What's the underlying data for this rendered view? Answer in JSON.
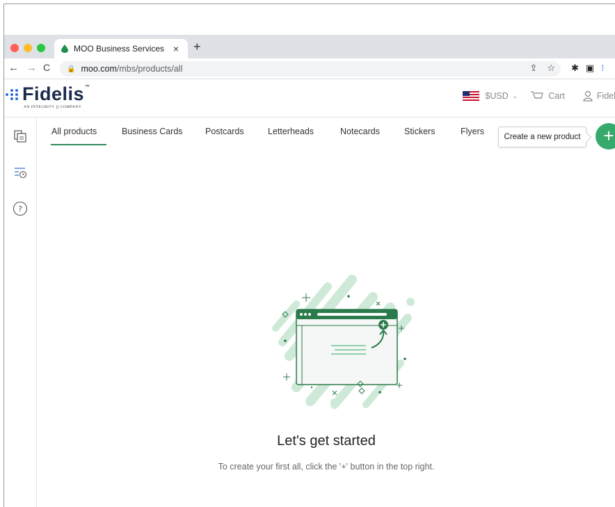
{
  "browser": {
    "tab_title": "MOO Business Services",
    "tab_close": "×",
    "new_tab": "+",
    "url_host": "moo.com",
    "url_path": "/mbs/products/all"
  },
  "header": {
    "logo_text": "Fidelis",
    "logo_tm": "™",
    "logo_sub": "AN INTEGRITY ][ COMPANY",
    "currency": "$USD",
    "cart": "Cart",
    "user": "Fidel"
  },
  "categories": [
    {
      "label": "All products",
      "active": true
    },
    {
      "label": "Business Cards"
    },
    {
      "label": "Postcards"
    },
    {
      "label": "Letterheads"
    },
    {
      "label": "Notecards"
    },
    {
      "label": "Stickers"
    },
    {
      "label": "Flyers"
    }
  ],
  "tooltip": "Create a new product",
  "fab": "+",
  "empty_state": {
    "title": "Let's get started",
    "subtitle": "To create your first all, click the '+' button in the top right."
  },
  "colors": {
    "accent": "#37a96a",
    "dark_green": "#2b7a4b",
    "light_green": "#cfe9d9"
  }
}
